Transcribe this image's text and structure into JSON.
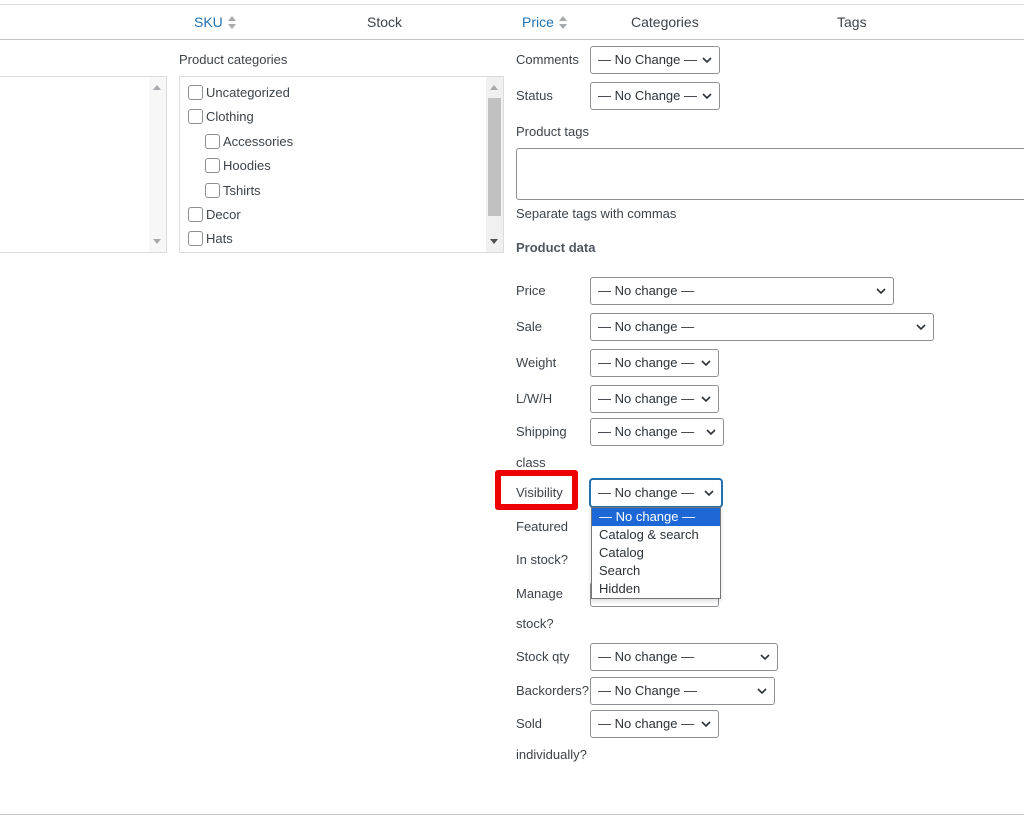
{
  "header": {
    "sku": "SKU",
    "stock": "Stock",
    "price": "Price",
    "categories": "Categories",
    "tags": "Tags"
  },
  "categories_panel": {
    "title": "Product categories",
    "items": [
      "Uncategorized",
      "Clothing",
      "Accessories",
      "Hoodies",
      "Tshirts",
      "Decor",
      "Hats"
    ]
  },
  "fields": {
    "comments": {
      "label": "Comments",
      "value": "— No Change —"
    },
    "status": {
      "label": "Status",
      "value": "— No Change —"
    },
    "product_tags": {
      "label": "Product tags",
      "hint": "Separate tags with commas"
    },
    "product_data": "Product data",
    "price": {
      "label": "Price",
      "value": "— No change —"
    },
    "sale": {
      "label": "Sale",
      "value": "— No change —"
    },
    "weight": {
      "label": "Weight",
      "value": "— No change —"
    },
    "lwh": {
      "label": "L/W/H",
      "value": "— No change —"
    },
    "shipping": {
      "label": "Shipping",
      "label2": "class",
      "value": "— No change —"
    },
    "visibility": {
      "label": "Visibility",
      "value": "— No change —",
      "options": [
        "— No change —",
        "Catalog & search",
        "Catalog",
        "Search",
        "Hidden"
      ],
      "selected_index": 0
    },
    "featured": {
      "label": "Featured"
    },
    "in_stock": {
      "label": "In stock?"
    },
    "manage_stock": {
      "label": "Manage",
      "label2": "stock?"
    },
    "stock_qty": {
      "label": "Stock qty",
      "value": "— No change —"
    },
    "backorders": {
      "label": "Backorders?",
      "value": "— No Change —"
    },
    "sold_individually": {
      "label": "Sold",
      "label2": "individually?",
      "value": "— No change —"
    }
  },
  "colors": {
    "link": "#2271b1",
    "highlight": "#ec0000",
    "option_selected": "#1e67d6"
  }
}
